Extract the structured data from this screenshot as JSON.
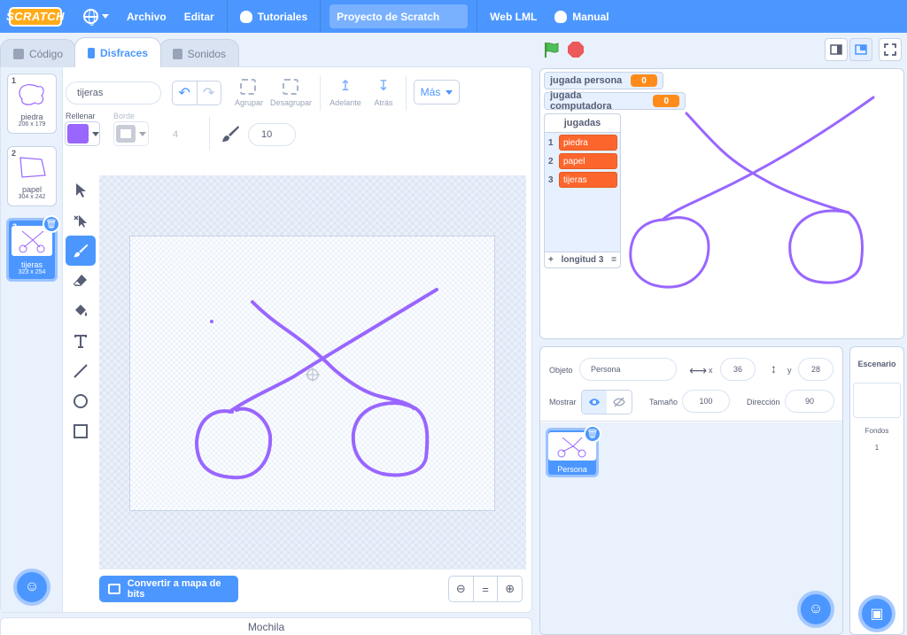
{
  "menubar": {
    "logo": "SCRATCH",
    "file": "Archivo",
    "edit": "Editar",
    "tutorials": "Tutoriales",
    "project_title": "Proyecto de Scratch",
    "web": "Web LML",
    "manual": "Manual"
  },
  "tabs": [
    {
      "label": "Código"
    },
    {
      "label": "Disfraces"
    },
    {
      "label": "Sonidos"
    }
  ],
  "costumes": [
    {
      "num": "1",
      "name": "piedra",
      "size": "206 x 179"
    },
    {
      "num": "2",
      "name": "papel",
      "size": "304 x 242"
    },
    {
      "num": "3",
      "name": "tijeras",
      "size": "323 x 254"
    }
  ],
  "paint": {
    "costume_name": "tijeras",
    "group": "Agrupar",
    "ungroup": "Desagrupar",
    "forward": "Adelante",
    "backward": "Atrás",
    "more": "Más",
    "fill_label": "Rellenar",
    "outline_label": "Borde",
    "outline_width": "4",
    "brush_size": "10",
    "fill_color": "#9966ff",
    "convert": "Convertir a mapa de bits",
    "zoom_reset": "="
  },
  "backpack": "Mochila",
  "monitors": {
    "player_label": "jugada persona",
    "player_value": "0",
    "computer_label": "jugada computadora",
    "computer_value": "0"
  },
  "list": {
    "title": "jugadas",
    "items": [
      {
        "idx": "1",
        "value": "piedra"
      },
      {
        "idx": "2",
        "value": "papel"
      },
      {
        "idx": "3",
        "value": "tijeras"
      }
    ],
    "add": "+",
    "length": "longitud 3",
    "resize": "="
  },
  "sprite": {
    "object_label": "Objeto",
    "name": "Persona",
    "x_label": "x",
    "x": "36",
    "y_label": "y",
    "y": "28",
    "show_label": "Mostrar",
    "size_label": "Tamaño",
    "size": "100",
    "direction_label": "Dirección",
    "direction": "90",
    "tile_name": "Persona"
  },
  "backdrop": {
    "title": "Escenario",
    "label": "Fondos",
    "count": "1"
  }
}
